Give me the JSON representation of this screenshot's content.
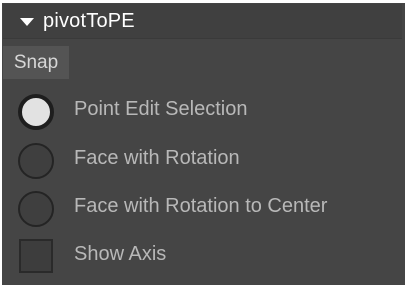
{
  "panel": {
    "title": "pivotToPE",
    "collapse_icon": "triangle-down-icon"
  },
  "tabs": [
    {
      "label": "Snap",
      "active": true
    }
  ],
  "options": [
    {
      "label": "Point Edit Selection",
      "type": "radio",
      "selected": true
    },
    {
      "label": "Face with Rotation",
      "type": "radio",
      "selected": false
    },
    {
      "label": "Face with Rotation to Center",
      "type": "radio",
      "selected": false
    }
  ],
  "show_axis": {
    "label": "Show Axis",
    "type": "checkbox",
    "checked": false
  },
  "colors": {
    "panel_bg": "#454545",
    "header_bg": "#404040",
    "tab_bg": "#545454",
    "label_text": "#b8b8b8",
    "header_text": "#ffffff",
    "radio_selected_fill": "#e2e2e2"
  }
}
